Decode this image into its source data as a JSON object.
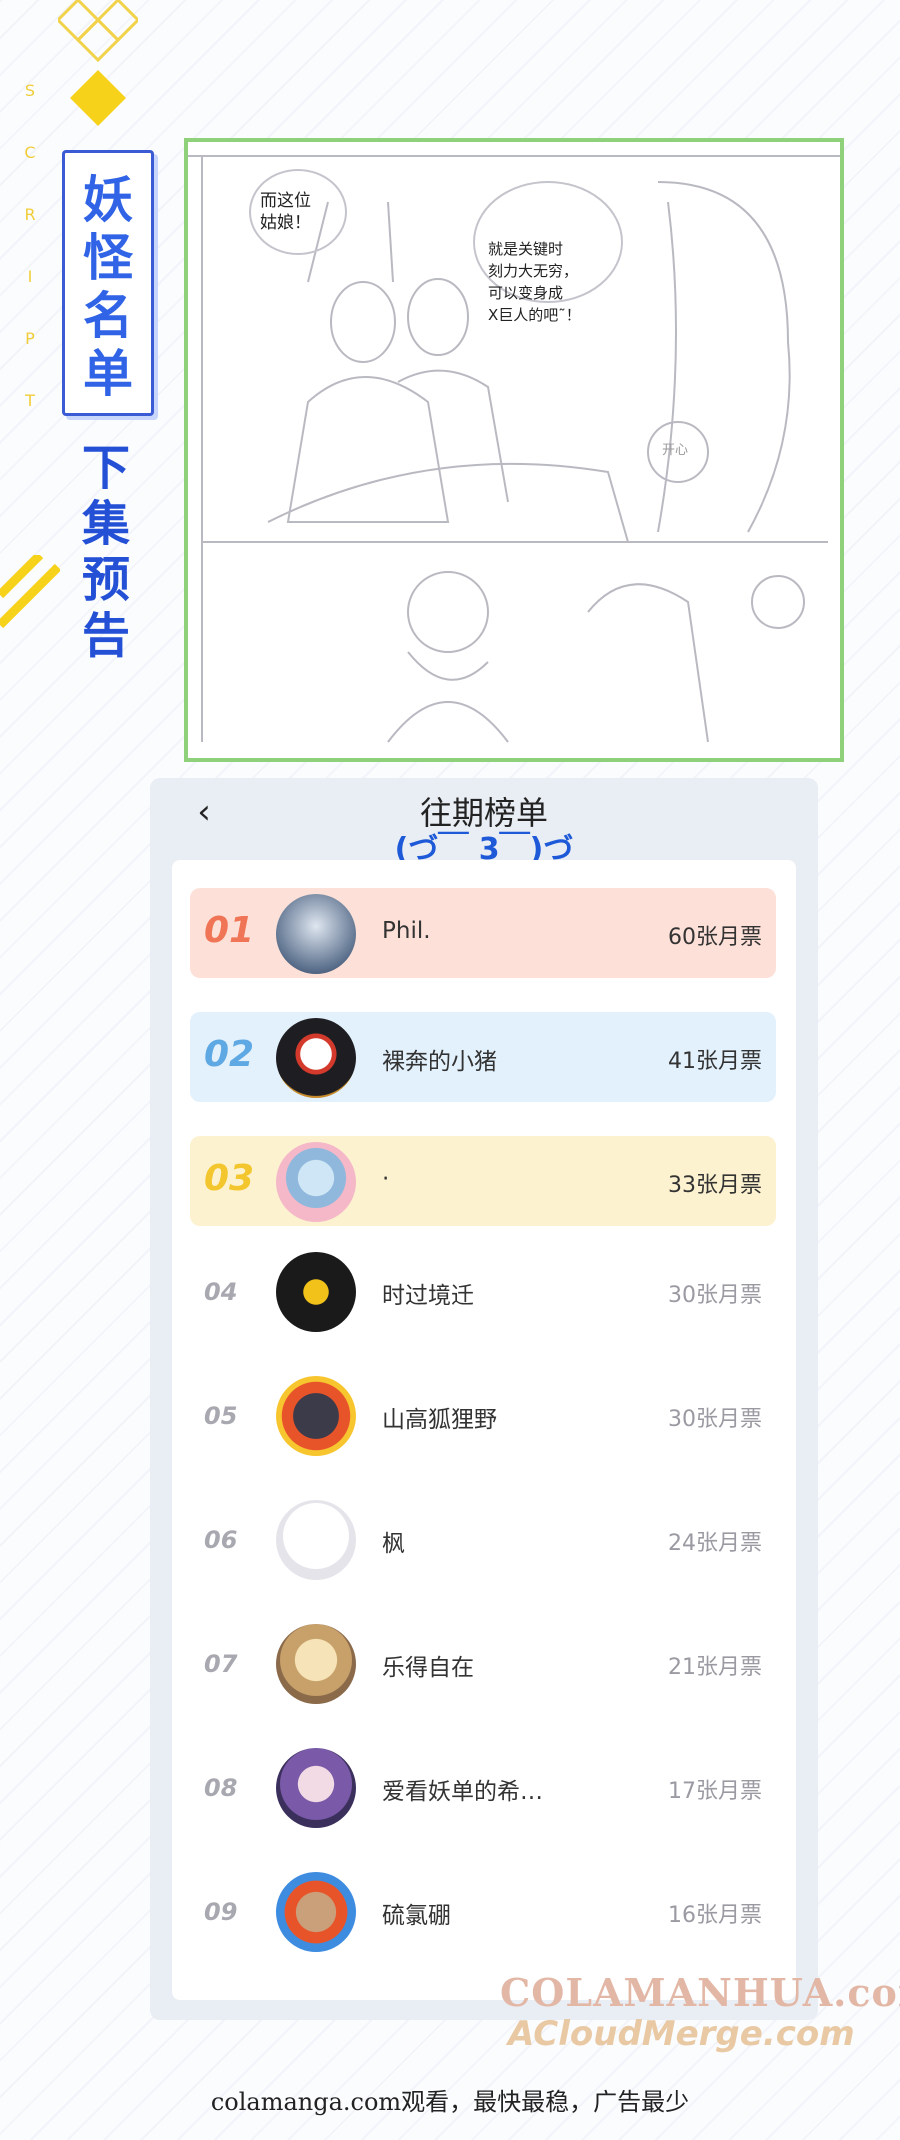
{
  "side": {
    "vertical_letters": [
      "S",
      "C",
      "R",
      "I",
      "P",
      "T"
    ],
    "logo_text": "妖怪名单",
    "preview_title": "下集预告"
  },
  "sketch": {
    "bubble_left": "而这位\n姑娘！",
    "bubble_right": "就是关键时\n刻力大无穷，\n可以变身成\nX巨人的吧˜！",
    "small_bubble": "开心"
  },
  "ranking": {
    "title": "往期榜单",
    "emoticon": "(づ￣ 3￣)づ",
    "back_icon": "chevron-left-icon",
    "rows": [
      {
        "rank": "01",
        "name": "Phil.",
        "votes": "60张月票",
        "bg": "#fde1d8",
        "color": "#f07456"
      },
      {
        "rank": "02",
        "name": "裸奔的小猪",
        "votes": "41张月票",
        "bg": "#e3f1fc",
        "color": "#5ea8e4"
      },
      {
        "rank": "03",
        "name": "·",
        "votes": "33张月票",
        "bg": "#fdf2d0",
        "color": "#f2c62c"
      },
      {
        "rank": "04",
        "name": "时过境迁",
        "votes": "30张月票"
      },
      {
        "rank": "05",
        "name": "山高狐狸野",
        "votes": "30张月票"
      },
      {
        "rank": "06",
        "name": "枫",
        "votes": "24张月票"
      },
      {
        "rank": "07",
        "name": "乐得自在",
        "votes": "21张月票"
      },
      {
        "rank": "08",
        "name": "爱看妖单的希…",
        "votes": "17张月票"
      },
      {
        "rank": "09",
        "name": "硫氯硼",
        "votes": "16张月票"
      }
    ]
  },
  "watermark": {
    "line1": "COLAMANHUA.com",
    "line2": "ACloudMerge.com"
  },
  "footer": "colamanga.com观看，最快最稳，广告最少"
}
